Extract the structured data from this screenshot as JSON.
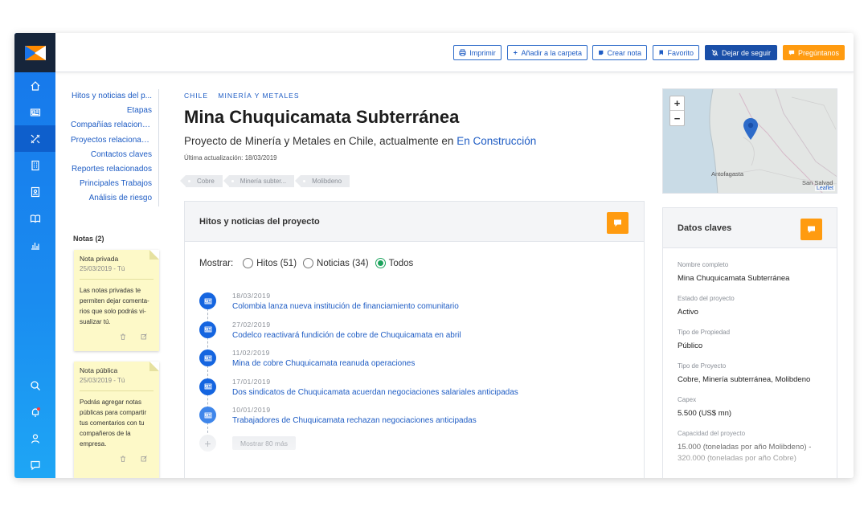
{
  "toolbar": {
    "print": "Imprimir",
    "add_folder": "Añadir a la carpeta",
    "create_note": "Crear nota",
    "favorite": "Favorito",
    "unfollow": "Dejar de seguir",
    "ask": "Pregúntanos"
  },
  "index": [
    "Hitos y noticias del p...",
    "Etapas",
    "Compañías relaciona...",
    "Proyectos relacionad...",
    "Contactos claves",
    "Reportes relacionados",
    "Principales Trabajos",
    "Análisis de riesgo"
  ],
  "notes": {
    "title": "Notas (2)",
    "items": [
      {
        "title": "Nota privada",
        "date": "25/03/2019 - Tú",
        "body": "Las notas privadas te permiten dejar comenta-rios que solo podrás vi-sualizar tú."
      },
      {
        "title": "Nota pública",
        "date": "25/03/2019 - Tú",
        "body": "Podrás agregar notas públicas para compartir tus comentarios con tu compañeros de la empresa."
      }
    ]
  },
  "project": {
    "country": "CHILE",
    "sector": "MINERÍA Y METALES",
    "title": "Mina Chuquicamata Subterránea",
    "subtitle": "Proyecto de Minería y Metales en Chile, actualmente en",
    "status_link": "En Construcción",
    "updated": "Última actualización: 18/03/2019",
    "tags": [
      "Cobre",
      "Minería subter...",
      "Molibdeno"
    ]
  },
  "hitos": {
    "title": "Hitos y noticias del proyecto",
    "show_label": "Mostrar:",
    "filters": [
      "Hitos (51)",
      "Noticias (34)",
      "Todos"
    ],
    "selected": "Todos",
    "items": [
      {
        "date": "18/03/2019",
        "text": "Colombia lanza nueva institución de financiamiento comunitario"
      },
      {
        "date": "27/02/2019",
        "text": "Codelco reactivará fundición de cobre de Chuquicamata en abril"
      },
      {
        "date": "11/02/2019",
        "text": "Mina de cobre Chuquicamata reanuda operaciones"
      },
      {
        "date": "17/01/2019",
        "text": "Dos sindicatos de Chuquicamata acuerdan negociaciones salariales anticipadas"
      },
      {
        "date": "10/01/2019",
        "text": "Trabajadores de Chuquicamata rechazan negociaciones anticipadas"
      }
    ],
    "more": "Mostrar 80 más"
  },
  "map": {
    "zoom_in": "+",
    "zoom_out": "−",
    "city1": "Antofagasta",
    "city2": "San Salvad",
    "attribution": "Leaflet"
  },
  "datos": {
    "title": "Datos claves",
    "fields": [
      {
        "label": "Nombre completo",
        "value": "Mina Chuquicamata Subterránea"
      },
      {
        "label": "Estado del proyecto",
        "value": "Activo"
      },
      {
        "label": "Tipo de Propiedad",
        "value": "Público"
      },
      {
        "label": "Tipo de Proyecto",
        "value": "Cobre, Minería subterránea, Molibdeno"
      },
      {
        "label": "Capex",
        "value": "5.500  (US$ mn)"
      },
      {
        "label": "Capacidad del proyecto",
        "value": "15.000 (toneladas por año Molibdeno)  -  320.000 (toneladas por año Cobre)"
      }
    ]
  },
  "colors": {
    "accent": "#1e5cc4",
    "orange": "#ff9b10",
    "rail": "#1676ea"
  }
}
